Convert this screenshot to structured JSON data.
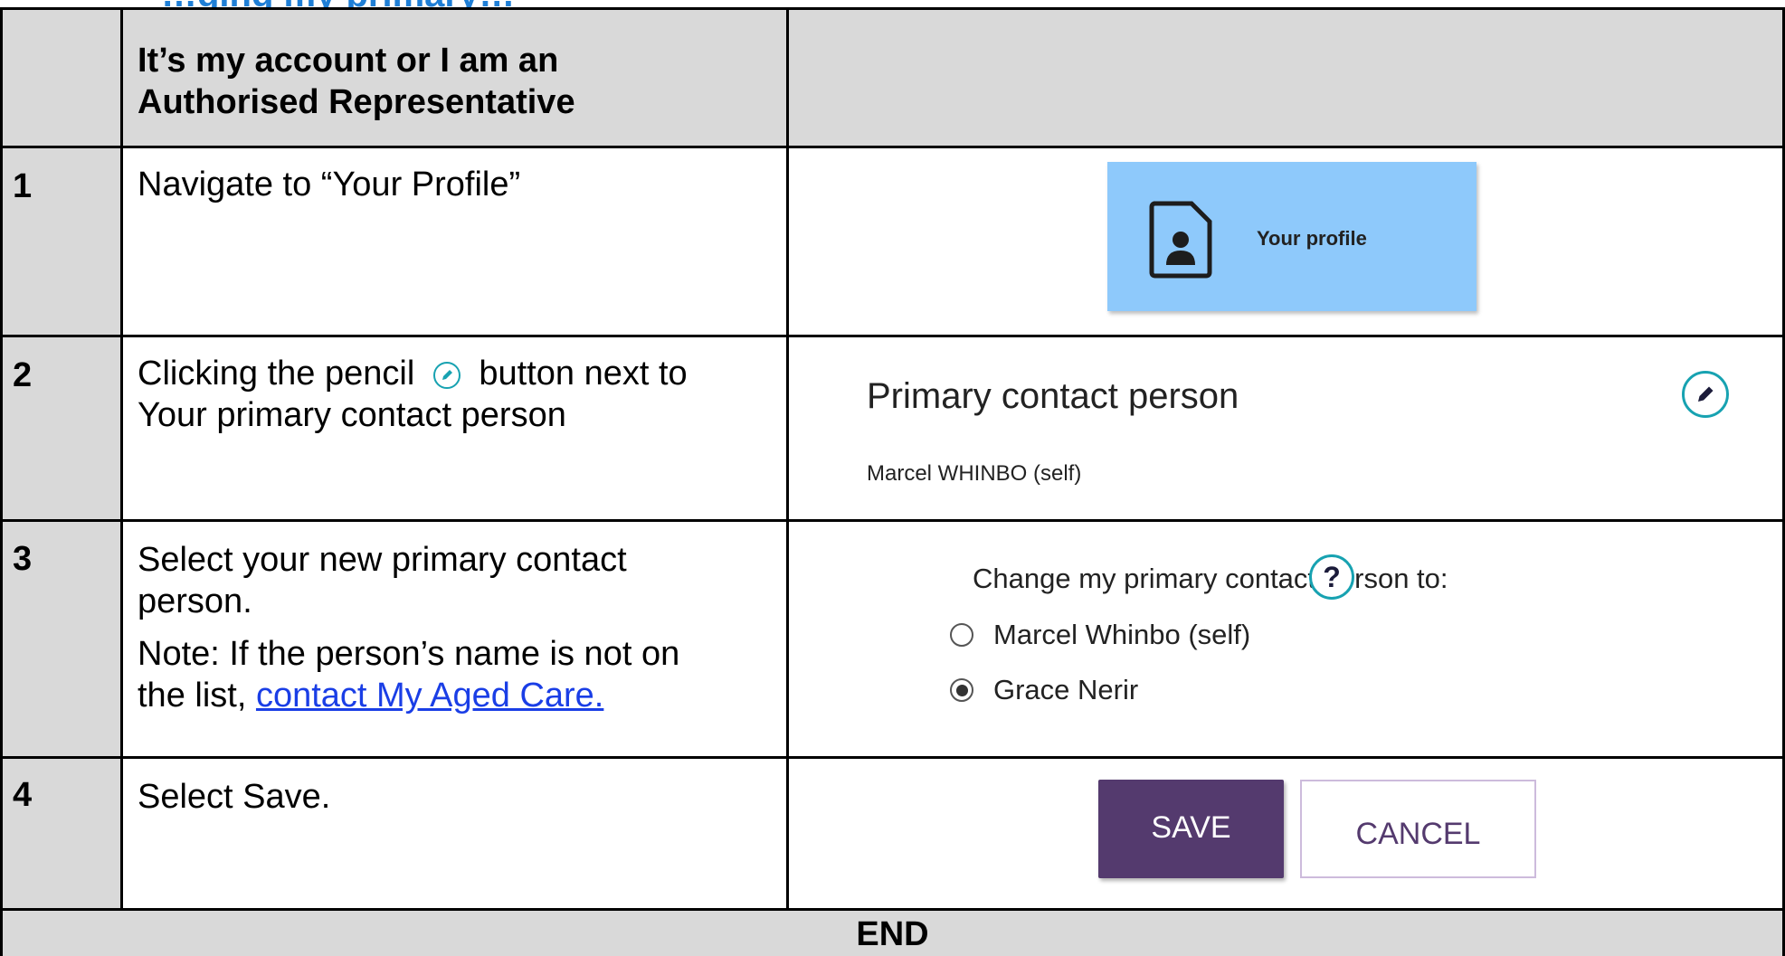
{
  "page": {
    "clipped_heading": "…ging my primary…"
  },
  "table": {
    "header": "It’s my account or I am an Authorised Representative",
    "header_line1": "It’s my account or I am an",
    "header_line2": "Authorised Representative",
    "rows": [
      {
        "num": "1",
        "line1": "Navigate to “Your Profile”"
      },
      {
        "num": "2",
        "line1_a": "Clicking the pencil",
        "line1_b": "button next to",
        "line2": "Your primary contact person"
      },
      {
        "num": "3",
        "line1": "Select your new primary contact",
        "line2": "person.",
        "note1": "Note: If the person’s name is not on",
        "note2_prefix": "the list,",
        "note_link": "contact My Aged Care."
      },
      {
        "num": "4",
        "line1": "Select Save."
      }
    ],
    "end_label": "END"
  },
  "screens": {
    "profile_tile": {
      "label": "Your profile",
      "icon": "profile-document-icon",
      "bg": "#8ec9fb"
    },
    "primary_contact": {
      "title": "Primary contact person",
      "name": "Marcel WHINBO (self)",
      "edit_icon": "pencil-icon",
      "accent": "#17a2b1"
    },
    "change_contact": {
      "prompt": "Change my primary contact person to:",
      "help_icon_label": "?",
      "options": [
        {
          "label": "Marcel Whinbo (self)",
          "selected": false
        },
        {
          "label": "Grace Nerir",
          "selected": true
        }
      ]
    },
    "actions": {
      "save_label": "SAVE",
      "cancel_label": "CANCEL",
      "save_bg": "#543a6e"
    }
  }
}
